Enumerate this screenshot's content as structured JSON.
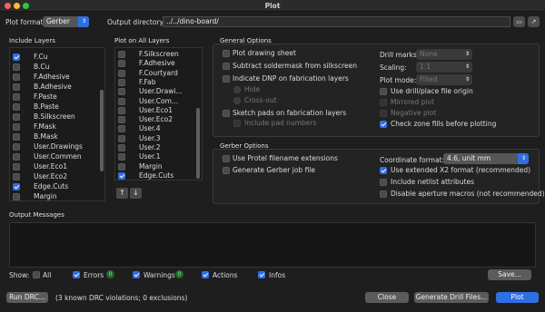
{
  "window": {
    "title": "Plot"
  },
  "top": {
    "plot_format_label": "Plot format:",
    "plot_format_value": "Gerber",
    "output_dir_label": "Output directory:",
    "output_dir_value": "../../dino-board/"
  },
  "include_layers": {
    "title": "Include Layers",
    "items": [
      {
        "label": "F.Cu",
        "checked": true
      },
      {
        "label": "B.Cu",
        "checked": false
      },
      {
        "label": "F.Adhesive",
        "checked": false
      },
      {
        "label": "B.Adhesive",
        "checked": false
      },
      {
        "label": "F.Paste",
        "checked": false
      },
      {
        "label": "B.Paste",
        "checked": false
      },
      {
        "label": "B.Silkscreen",
        "checked": false
      },
      {
        "label": "F.Mask",
        "checked": false
      },
      {
        "label": "B.Mask",
        "checked": false
      },
      {
        "label": "User.Drawings",
        "checked": false
      },
      {
        "label": "User.Commen",
        "checked": false
      },
      {
        "label": "User.Eco1",
        "checked": false
      },
      {
        "label": "User.Eco2",
        "checked": false
      },
      {
        "label": "Edge.Cuts",
        "checked": true
      },
      {
        "label": "Margin",
        "checked": false
      }
    ]
  },
  "plot_on_all": {
    "title": "Plot on All Layers",
    "items": [
      {
        "label": "F.Silkscreen",
        "checked": false
      },
      {
        "label": "F.Adhesive",
        "checked": false
      },
      {
        "label": "F.Courtyard",
        "checked": false
      },
      {
        "label": "F.Fab",
        "checked": false
      },
      {
        "label": "User.Drawi...",
        "checked": false
      },
      {
        "label": "User.Com...",
        "checked": false
      },
      {
        "label": "User.Eco1",
        "checked": false
      },
      {
        "label": "User.Eco2",
        "checked": false
      },
      {
        "label": "User.4",
        "checked": false
      },
      {
        "label": "User.3",
        "checked": false
      },
      {
        "label": "User.2",
        "checked": false
      },
      {
        "label": "User.1",
        "checked": false
      },
      {
        "label": "Margin",
        "checked": false
      },
      {
        "label": "Edge.Cuts",
        "checked": true
      }
    ],
    "up_glyph": "↑",
    "down_glyph": "↓"
  },
  "general": {
    "title": "General Options",
    "plot_drawing_sheet": "Plot drawing sheet",
    "subtract_soldermask": "Subtract soldermask from silkscreen",
    "indicate_dnp": "Indicate DNP on fabrication layers",
    "hide": "Hide",
    "cross_out": "Cross-out",
    "sketch_pads": "Sketch pads on fabrication layers",
    "include_pad_numbers": "Include pad numbers",
    "drill_marks_label": "Drill marks:",
    "drill_marks_value": "None",
    "scaling_label": "Scaling:",
    "scaling_value": "1:1",
    "plot_mode_label": "Plot mode:",
    "plot_mode_value": "Filled",
    "use_drill_origin": "Use drill/place file origin",
    "mirrored_plot": "Mirrored plot",
    "negative_plot": "Negative plot",
    "check_zone_fills": "Check zone fills before plotting"
  },
  "gerber": {
    "title": "Gerber Options",
    "use_protel": "Use Protel filename extensions",
    "generate_job": "Generate Gerber job file",
    "coord_format_label": "Coordinate format:",
    "coord_format_value": "4.6, unit mm",
    "use_x2": "Use extended X2 format (recommended)",
    "include_netlist": "Include netlist attributes",
    "disable_aperture": "Disable aperture macros (not recommended)"
  },
  "output": {
    "title": "Output Messages",
    "show_label": "Show:",
    "all": "All",
    "errors": "Errors",
    "errors_count": "0",
    "warnings": "Warnings",
    "warnings_count": "0",
    "actions": "Actions",
    "infos": "Infos",
    "save": "Save..."
  },
  "footer": {
    "run_drc": "Run DRC...",
    "drc_status": "(3 known DRC violations; 0 exclusions)",
    "close": "Close",
    "generate_drill": "Generate Drill Files...",
    "plot": "Plot"
  },
  "colors": {
    "accent": "#2f6fe4",
    "badge": "#1e6b2c"
  }
}
